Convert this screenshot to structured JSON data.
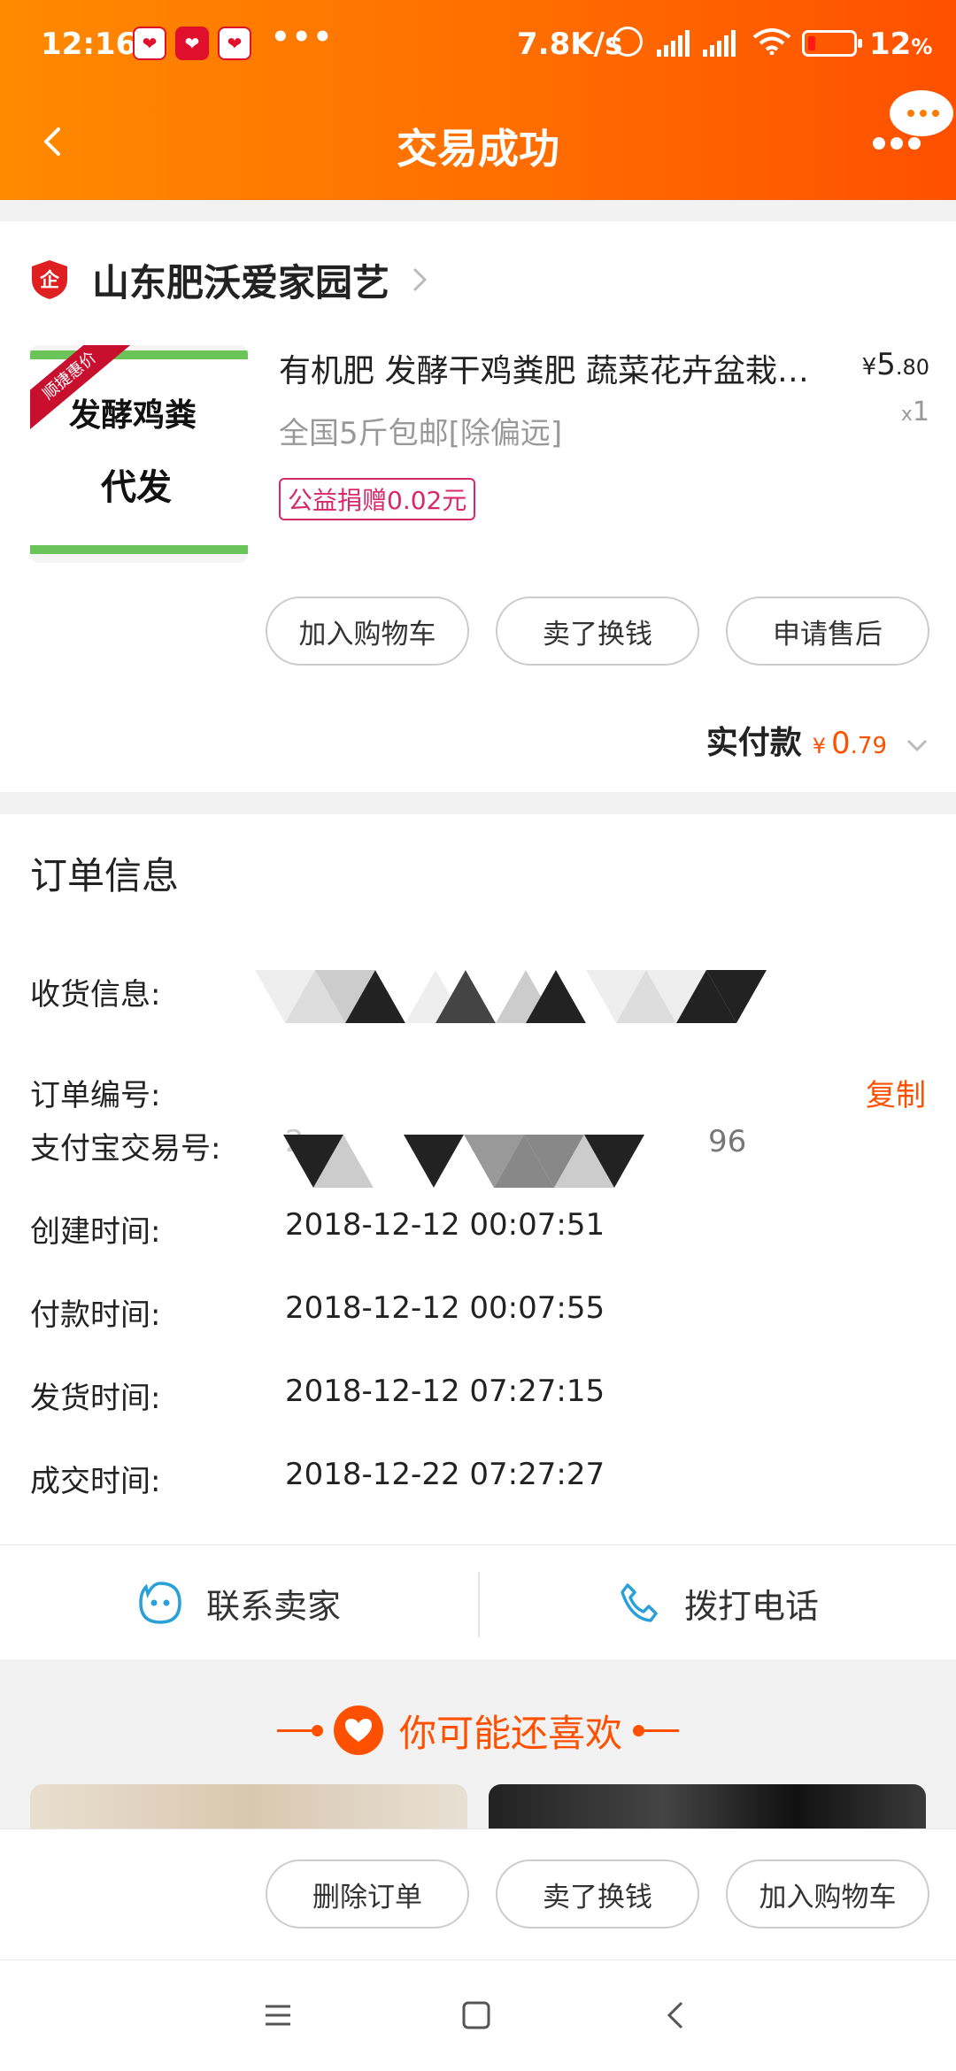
{
  "status_bar": {
    "time": "12:16",
    "dots": "•••",
    "net_speed": "7.8K/s",
    "battery_pct": "12",
    "battery_unit": "%"
  },
  "nav": {
    "title": "交易成功"
  },
  "shop": {
    "name": "山东肥沃爱家园艺",
    "logo_glyph": "企"
  },
  "product": {
    "title": "有机肥 发酵干鸡粪肥 蔬菜花卉盆栽果树",
    "sku": "全国5斤包邮[除偏远]",
    "tag": "公益捐赠0.02元",
    "price_symbol": "¥",
    "price_int": "5",
    "price_dec": ".80",
    "qty_prefix": "x",
    "qty": "1",
    "image_text_top": "发酵鸡粪",
    "image_text_bottom": "代发",
    "image_ribbon": "顺捷惠价"
  },
  "item_buttons": [
    "加入购物车",
    "卖了换钱",
    "申请售后"
  ],
  "paid": {
    "label": "实付款",
    "symbol": "¥",
    "amount_int": "0",
    "amount_dec": ".79"
  },
  "order": {
    "title": "订单信息",
    "address_label": "收货信息:",
    "order_no_label": "订单编号:",
    "copy_label": "复制",
    "alipay_label": "支付宝交易号:",
    "alipay_prefix": "2",
    "alipay_suffix": "96",
    "created_label": "创建时间:",
    "created_value": "2018-12-12 00:07:51",
    "paid_label": "付款时间:",
    "paid_value": "2018-12-12 00:07:55",
    "shipped_label": "发货时间:",
    "shipped_value": "2018-12-12 07:27:15",
    "closed_label": "成交时间:",
    "closed_value": "2018-12-22 07:27:27"
  },
  "actions": {
    "contact": "联系卖家",
    "call": "拨打电话"
  },
  "recommend": {
    "title": "你可能还喜欢"
  },
  "bottom_buttons": [
    "删除订单",
    "卖了换钱",
    "加入购物车"
  ],
  "colors": {
    "brand": "#ff5000",
    "header_start": "#ff8a00",
    "tag": "#d7296a",
    "icon_blue": "#2aa0d8"
  }
}
